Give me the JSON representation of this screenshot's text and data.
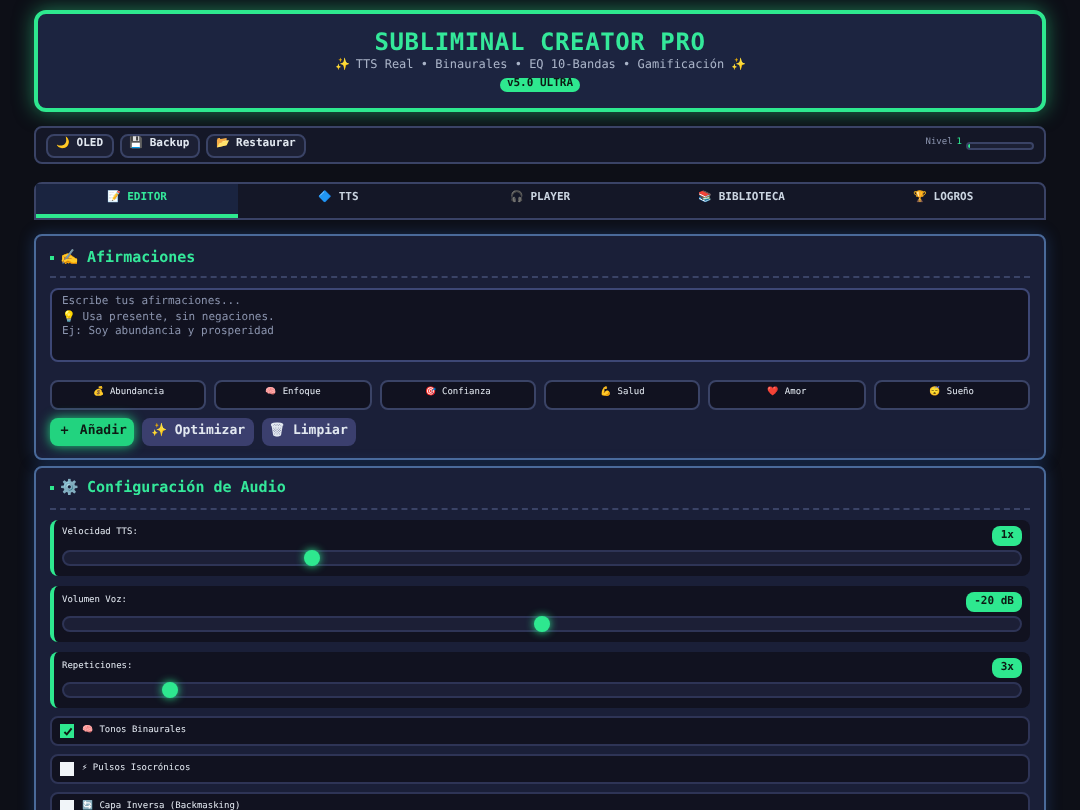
{
  "header": {
    "title": "SUBLIMINAL CREATOR PRO",
    "subtitle": "✨ TTS Real • Binaurales • EQ 10-Bandas • Gamificación ✨",
    "badge": "v5.0 ULTRA"
  },
  "toolbar": {
    "buttons": [
      {
        "icon": "🌙",
        "label": "OLED"
      },
      {
        "icon": "💾",
        "label": "Backup"
      },
      {
        "icon": "📂",
        "label": "Restaurar"
      }
    ],
    "level_label": "Nivel",
    "level_value": "1",
    "xp": {
      "level": 0.03
    }
  },
  "tabs": [
    {
      "icon": "📝",
      "label": "EDITOR",
      "selected": true
    },
    {
      "icon": "🔷",
      "label": "TTS",
      "selected": false
    },
    {
      "icon": "🎧",
      "label": "PLAYER",
      "selected": false
    },
    {
      "icon": "📚",
      "label": "BIBLIOTECA",
      "selected": false
    },
    {
      "icon": "🏆",
      "label": "LOGROS",
      "selected": false
    }
  ],
  "affirmations": {
    "title": "✍️ Afirmaciones",
    "placeholder_lines": [
      "Escribe tus afirmaciones...",
      "💡 Usa presente, sin negaciones.",
      "Ej: Soy abundancia y prosperidad"
    ],
    "categories": [
      {
        "icon": "💰",
        "label": "Abundancia"
      },
      {
        "icon": "🧠",
        "label": "Enfoque"
      },
      {
        "icon": "🎯",
        "label": "Confianza"
      },
      {
        "icon": "💪",
        "label": "Salud"
      },
      {
        "icon": "❤️",
        "label": "Amor"
      },
      {
        "icon": "😴",
        "label": "Sueño"
      }
    ],
    "actions": [
      {
        "kind": "primary",
        "label": "＋ Añadir"
      },
      {
        "kind": "secondary",
        "label": "✨ Optimizar"
      },
      {
        "kind": "secondary",
        "label": "🗑 Limpiar"
      }
    ]
  },
  "audio": {
    "title": "⚙️ Configuración de Audio",
    "sliders": [
      {
        "label": "Velocidad TTS:",
        "reading": "1x",
        "level": 0.26
      },
      {
        "label": "Volumen Voz:",
        "reading": "-20 dB",
        "level": 0.5
      },
      {
        "label": "Repeticiones:",
        "reading": "3x",
        "level": 0.11
      }
    ],
    "options": [
      {
        "label": "🧠 Tonos Binaurales",
        "checked": true
      },
      {
        "label": "⚡ Pulsos Isocrónicos",
        "checked": false
      },
      {
        "label": "🔄 Capa Inversa (Backmasking)",
        "checked": false
      }
    ]
  }
}
